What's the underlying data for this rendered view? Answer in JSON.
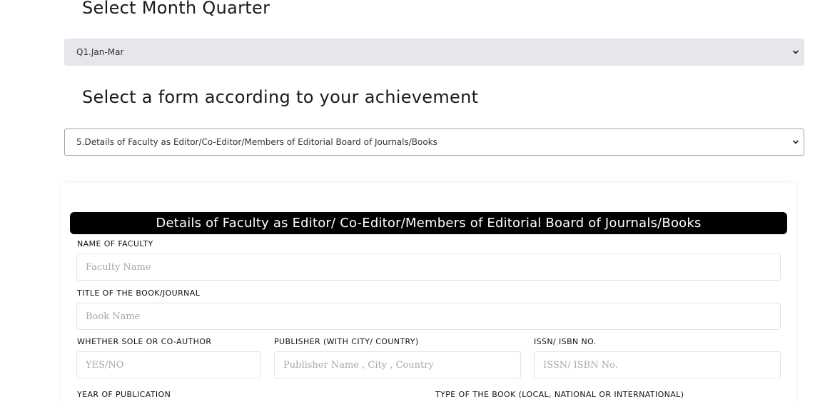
{
  "quarter_section": {
    "heading": "Select Month Quarter",
    "selected": "Q1.Jan-Mar"
  },
  "form_section": {
    "heading": "Select a form according to your achievement",
    "selected": "5.Details of Faculty as Editor/Co-Editor/Members of Editorial Board of Journals/Books"
  },
  "form": {
    "title": "Details of Faculty as Editor/ Co-Editor/Members of Editorial Board of Journals/Books",
    "fields": {
      "faculty_name": {
        "label": "NAME OF FACULTY",
        "placeholder": "Faculty Name",
        "value": ""
      },
      "book_title": {
        "label": "TITLE OF THE BOOK/JOURNAL",
        "placeholder": "Book Name",
        "value": ""
      },
      "sole_coauthor": {
        "label": "WHETHER SOLE OR CO-AUTHOR",
        "placeholder": "YES/NO",
        "value": ""
      },
      "publisher": {
        "label": "PUBLISHER (WITH CITY/ COUNTRY)",
        "placeholder": "Publisher Name , City , Country",
        "value": ""
      },
      "issn": {
        "label": "ISSN/ ISBN NO.",
        "placeholder": "ISSN/ ISBN No.",
        "value": ""
      },
      "year": {
        "label": "YEAR OF PUBLICATION"
      },
      "book_type": {
        "label": "TYPE OF THE BOOK (LOCAL, NATIONAL OR INTERNATIONAL)"
      }
    }
  },
  "icons": {
    "select_arrow": "chevron-down-icon"
  }
}
